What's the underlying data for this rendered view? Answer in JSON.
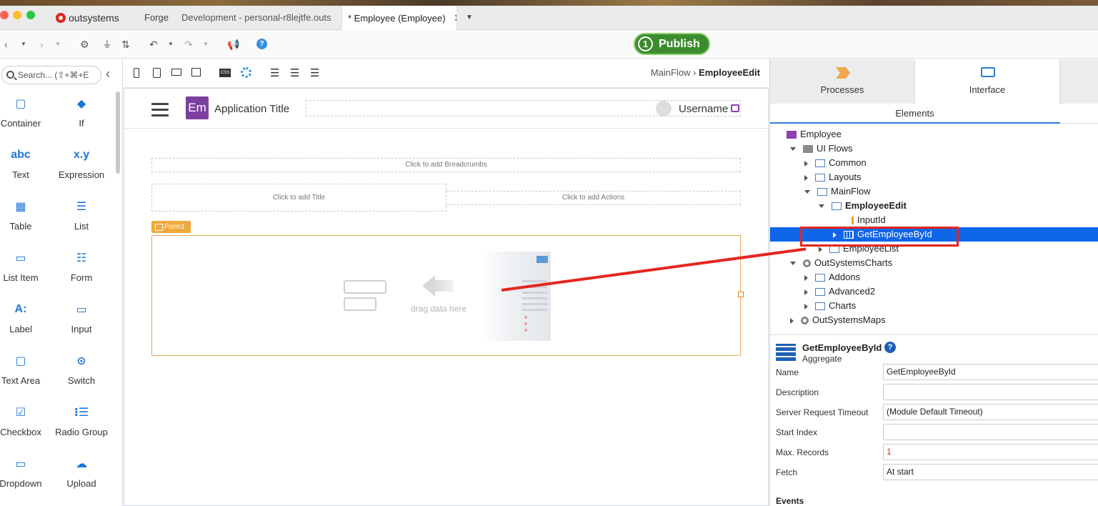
{
  "window": {
    "tabs": [
      "Forge",
      "Development - personal-r8lejtfe.outsys",
      "* Employee (Employee)"
    ],
    "brand": "outsystems"
  },
  "toolbar": {
    "publish_number": "1",
    "publish_label": "Publish"
  },
  "palette": {
    "search_placeholder": "Search... (⇧+⌘+E",
    "items": [
      {
        "label": "Container",
        "icon": "container-icon",
        "glyph": "▢"
      },
      {
        "label": "If",
        "icon": "if-icon",
        "glyph": "◆"
      },
      {
        "label": "Text",
        "icon": "text-icon",
        "glyph": "abc"
      },
      {
        "label": "Expression",
        "icon": "expression-icon",
        "glyph": "x.y"
      },
      {
        "label": "Table",
        "icon": "table-icon",
        "glyph": "▦"
      },
      {
        "label": "List",
        "icon": "list-icon",
        "glyph": "☰"
      },
      {
        "label": "List Item",
        "icon": "list-item-icon",
        "glyph": "▭"
      },
      {
        "label": "Form",
        "icon": "form-icon",
        "glyph": "☷"
      },
      {
        "label": "Label",
        "icon": "label-icon",
        "glyph": "A:"
      },
      {
        "label": "Input",
        "icon": "input-icon",
        "glyph": "▭"
      },
      {
        "label": "Text Area",
        "icon": "text-area-icon",
        "glyph": "▢"
      },
      {
        "label": "Switch",
        "icon": "switch-icon",
        "glyph": "⊙"
      },
      {
        "label": "Checkbox",
        "icon": "checkbox-icon",
        "glyph": "☑"
      },
      {
        "label": "Radio Group",
        "icon": "radio-group-icon",
        "glyph": "⁝☰"
      },
      {
        "label": "Dropdown",
        "icon": "dropdown-icon",
        "glyph": "▭"
      },
      {
        "label": "Upload",
        "icon": "upload-icon",
        "glyph": "☁"
      }
    ]
  },
  "canvas": {
    "breadcrumb_flow": "MainFlow",
    "breadcrumb_screen": "EmployeeEdit",
    "app_logo": "Em",
    "app_title": "Application Title",
    "username": "Username",
    "breadcrumbs_placeholder": "Click to add Breadcrumbs",
    "title_placeholder": "Click to add Title",
    "actions_placeholder": "Click to add Actions",
    "form_tag": "Form1",
    "drag_hint": "drag data here"
  },
  "right_panel": {
    "tabs": [
      "Processes",
      "Interface"
    ],
    "elements_tab": "Elements",
    "tree": [
      {
        "label": "Employee",
        "depth": 0,
        "caret": "none",
        "icon": "module"
      },
      {
        "label": "UI Flows",
        "depth": 1,
        "caret": "down",
        "icon": "folder"
      },
      {
        "label": "Common",
        "depth": 2,
        "caret": "right",
        "icon": "flow"
      },
      {
        "label": "Layouts",
        "depth": 2,
        "caret": "right",
        "icon": "flow"
      },
      {
        "label": "MainFlow",
        "depth": 2,
        "caret": "down",
        "icon": "flow"
      },
      {
        "label": "EmployeeEdit",
        "depth": 3,
        "caret": "down",
        "icon": "screen",
        "bold": true
      },
      {
        "label": "InputId",
        "depth": 4,
        "caret": "none",
        "icon": "input-param"
      },
      {
        "label": "GetEmployeeById",
        "depth": 4,
        "caret": "right",
        "icon": "aggregate",
        "selected": true
      },
      {
        "label": "EmployeeList",
        "depth": 3,
        "caret": "right",
        "icon": "home-screen"
      },
      {
        "label": "OutSystemsCharts",
        "depth": 1,
        "caret": "down",
        "icon": "reference"
      },
      {
        "label": "Addons",
        "depth": 2,
        "caret": "right",
        "icon": "flow"
      },
      {
        "label": "Advanced2",
        "depth": 2,
        "caret": "right",
        "icon": "flow"
      },
      {
        "label": "Charts",
        "depth": 2,
        "caret": "right",
        "icon": "flow"
      },
      {
        "label": "OutSystemsMaps",
        "depth": 1,
        "caret": "right",
        "icon": "reference"
      }
    ],
    "selected_name": "GetEmployeeById",
    "selected_type": "Aggregate",
    "properties": [
      {
        "label": "Name",
        "value": "GetEmployeeById"
      },
      {
        "label": "Description",
        "value": ""
      },
      {
        "label": "Server Request Timeout",
        "value": "(Module Default Timeout)"
      },
      {
        "label": "Start Index",
        "value": ""
      },
      {
        "label": "Max. Records",
        "value": "1"
      },
      {
        "label": "Fetch",
        "value": "At start"
      }
    ],
    "events_label": "Events"
  },
  "colors": {
    "publish_green": "#3d8b2f",
    "selection_blue": "#0f66e8",
    "annotation_red": "#e52620",
    "form_orange": "#f0a93b",
    "brand_purple": "#7c3fa0"
  }
}
